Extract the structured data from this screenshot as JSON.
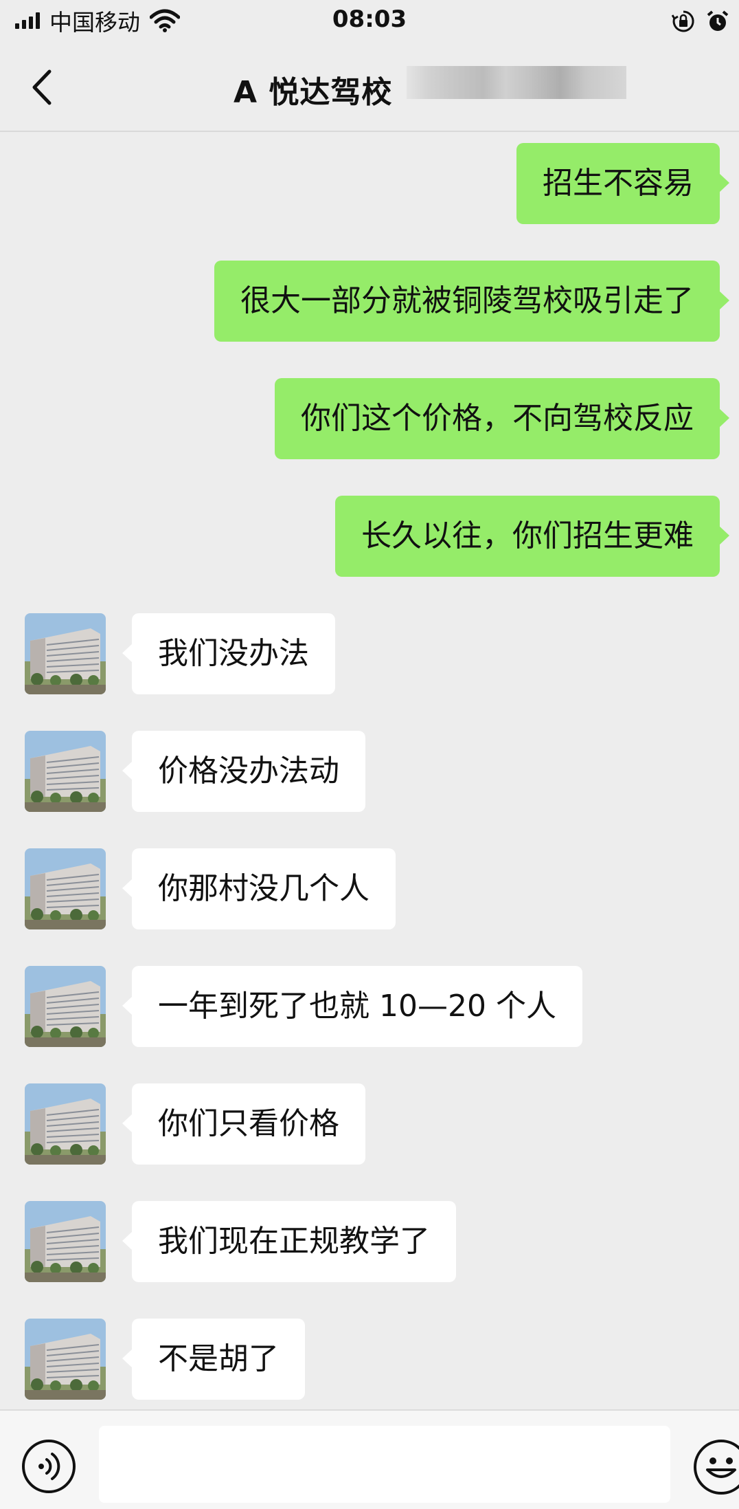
{
  "status_bar": {
    "carrier": "中国移动",
    "time": "08:03",
    "icons": [
      "signal-icon",
      "wifi-icon",
      "orientation-lock-icon",
      "alarm-icon"
    ]
  },
  "header": {
    "title": "A 悦达驾校 ",
    "back_icon": "chevron-left-icon"
  },
  "messages": [
    {
      "side": "sent",
      "text": "招生不容易"
    },
    {
      "side": "sent",
      "text": "很大一部分就被铜陵驾校吸引走了"
    },
    {
      "side": "sent",
      "text": "你们这个价格，不向驾校反应"
    },
    {
      "side": "sent",
      "text": "长久以往，你们招生更难"
    },
    {
      "side": "received",
      "text": "我们没办法"
    },
    {
      "side": "received",
      "text": "价格没办法动"
    },
    {
      "side": "received",
      "text": "你那村没几个人"
    },
    {
      "side": "received",
      "text": "一年到死了也就 10—20 个人"
    },
    {
      "side": "received",
      "text": "你们只看价格"
    },
    {
      "side": "received",
      "text": "我们现在正规教学了"
    },
    {
      "side": "received",
      "text": "不是胡了"
    }
  ],
  "input_bar": {
    "voice_icon": "voice-icon",
    "input_value": "",
    "emoji_icon": "emoji-icon"
  },
  "colors": {
    "background": "#ededed",
    "sent_bubble": "#95ec69",
    "received_bubble": "#ffffff"
  }
}
